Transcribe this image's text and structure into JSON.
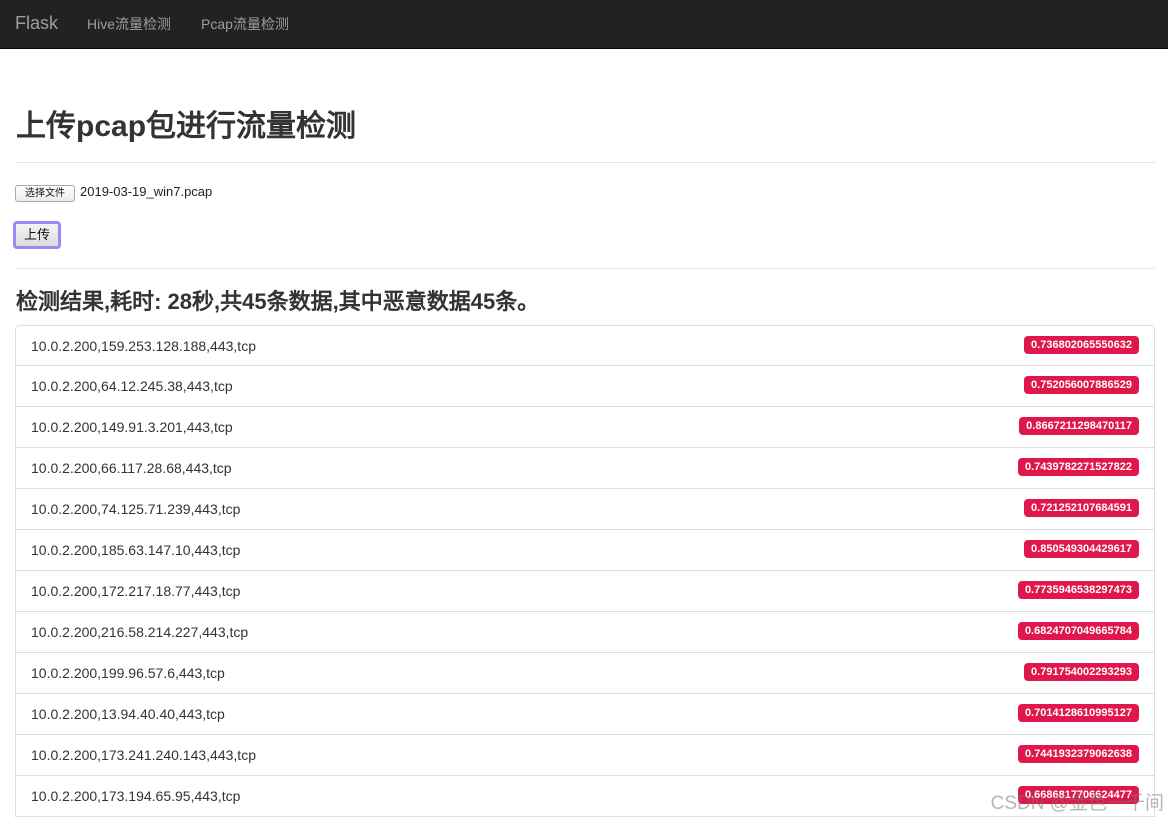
{
  "navbar": {
    "brand": "Flask",
    "links": [
      "Hive流量检测",
      "Pcap流量检测"
    ]
  },
  "page_title": "上传pcap包进行流量检测",
  "file_input": {
    "button_label": "选择文件",
    "file_name": "2019-03-19_win7.pcap"
  },
  "upload_button": "上传",
  "result_title": "检测结果,耗时: 28秒,共45条数据,其中恶意数据45条。",
  "results": [
    {
      "flow": "10.0.2.200,159.253.128.188,443,tcp",
      "score": "0.736802065550632"
    },
    {
      "flow": "10.0.2.200,64.12.245.38,443,tcp",
      "score": "0.752056007886529"
    },
    {
      "flow": "10.0.2.200,149.91.3.201,443,tcp",
      "score": "0.8667211298470117"
    },
    {
      "flow": "10.0.2.200,66.117.28.68,443,tcp",
      "score": "0.7439782271527822"
    },
    {
      "flow": "10.0.2.200,74.125.71.239,443,tcp",
      "score": "0.721252107684591"
    },
    {
      "flow": "10.0.2.200,185.63.147.10,443,tcp",
      "score": "0.850549304429617"
    },
    {
      "flow": "10.0.2.200,172.217.18.77,443,tcp",
      "score": "0.7735946538297473"
    },
    {
      "flow": "10.0.2.200,216.58.214.227,443,tcp",
      "score": "0.6824707049665784"
    },
    {
      "flow": "10.0.2.200,199.96.57.6,443,tcp",
      "score": "0.791754002293293"
    },
    {
      "flow": "10.0.2.200,13.94.40.40,443,tcp",
      "score": "0.7014128610995127"
    },
    {
      "flow": "10.0.2.200,173.241.240.143,443,tcp",
      "score": "0.7441932379062638"
    },
    {
      "flow": "10.0.2.200,173.194.65.95,443,tcp",
      "score": "0.6686817706624477"
    }
  ],
  "watermark": "CSDN @金色一千间"
}
